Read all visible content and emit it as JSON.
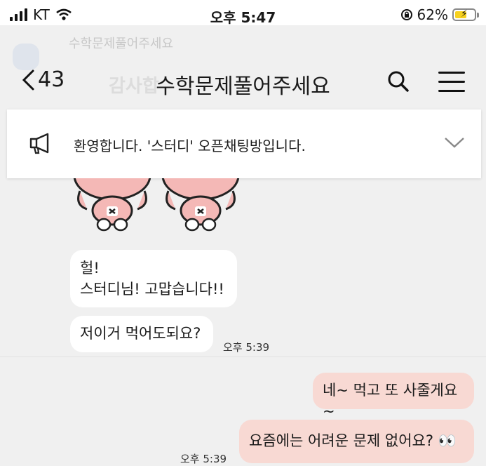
{
  "status_bar": {
    "carrier": "KT",
    "time": "오후 5:47",
    "battery_percent": "62%",
    "battery_level": 0.62,
    "icons": [
      "signal-icon",
      "wifi-icon",
      "rotation-lock-icon",
      "battery-icon"
    ]
  },
  "header": {
    "back_count": "43",
    "title": "수학문제풀어주세요",
    "background_title": "수학문제풀어주세요",
    "background_mark": "감사합"
  },
  "notice": {
    "text": "환영합니다. '스터디' 오픈채팅방입니다."
  },
  "messages": [
    {
      "side": "left",
      "text_lines": [
        "헐!",
        "스터디님! 고맙습니다!!"
      ]
    },
    {
      "side": "left",
      "text": "저이거 먹어도되요?",
      "time": "오후 5:39"
    },
    {
      "side": "right",
      "text": "네~ 먹고 또 사줄게요~"
    },
    {
      "side": "right",
      "text": "요즘에는 어려운 문제 없어요? 👀",
      "time": "오후 5:39"
    }
  ],
  "colors": {
    "chat_background": "#f0f0f0",
    "my_bubble": "#f8d9d3",
    "other_bubble": "#ffffff",
    "battery_fill": "#f7d11e",
    "sticker_pink": "#f4b8b6"
  }
}
